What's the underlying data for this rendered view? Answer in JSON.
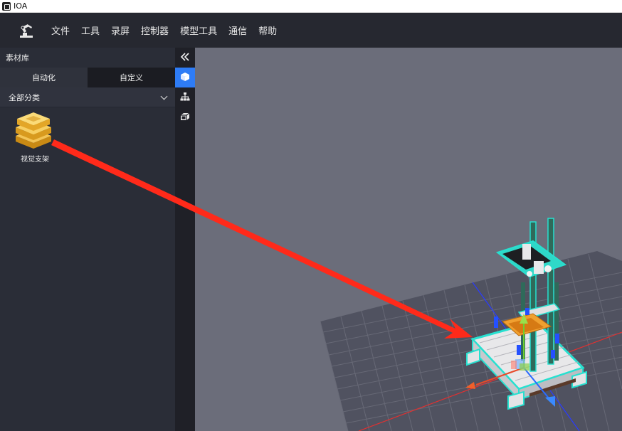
{
  "window": {
    "title": "IOA",
    "app_icon": "app-icon"
  },
  "menubar": {
    "logo_icon": "robot-arm-logo-icon",
    "items": [
      "文件",
      "工具",
      "录屏",
      "控制器",
      "模型工具",
      "通信",
      "帮助"
    ]
  },
  "left_panel": {
    "header": "素材库",
    "tabs": [
      {
        "label": "自动化",
        "active": true
      },
      {
        "label": "自定义",
        "active": false
      }
    ],
    "category": {
      "selected": "全部分类"
    },
    "assets": [
      {
        "label": "视觉支架",
        "icon": "stacked-box-asset-icon"
      }
    ]
  },
  "side_toolbar": {
    "tools": [
      {
        "icon": "collapse-double-chevron-icon",
        "active": false
      },
      {
        "icon": "cube-icon",
        "active": true
      },
      {
        "icon": "hierarchy-icon",
        "active": false
      },
      {
        "icon": "cube-outline-icon",
        "active": false
      }
    ]
  },
  "colors": {
    "accent": "#2e7cf6",
    "viewport_bg": "#6b6d7a",
    "highlight": "#27e0d0",
    "annotation_arrow": "#ff2a1a"
  }
}
